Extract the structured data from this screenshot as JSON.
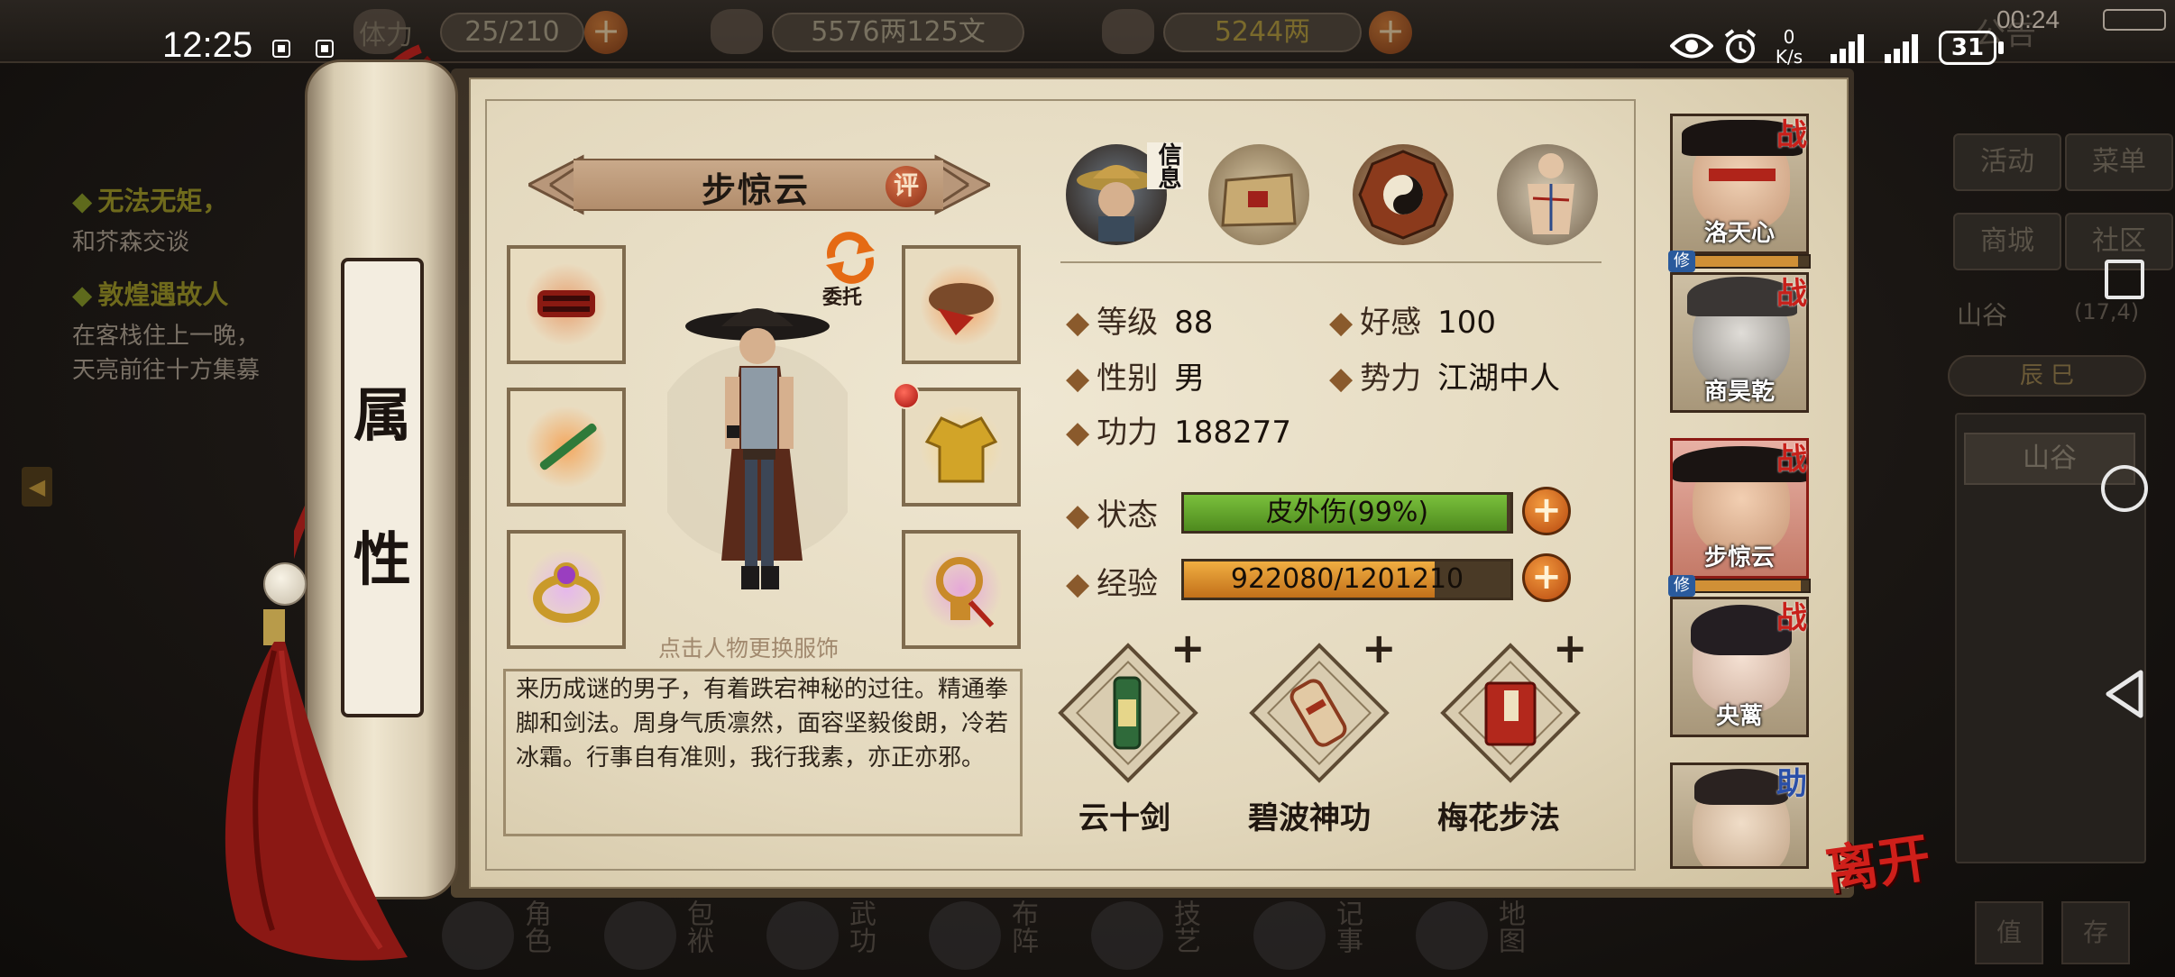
{
  "status_bar": {
    "time": "12:25",
    "net_speed_value": "0",
    "net_speed_unit": "K/s",
    "battery": "31",
    "game_clock": "00:24"
  },
  "top_bar": {
    "stamina_label": "体力",
    "stamina": "25/210",
    "silver": "5576两125文",
    "gold": "5244两",
    "right_label": "公告"
  },
  "quests": [
    {
      "title": "无法无矩，",
      "desc": "和芥森交谈"
    },
    {
      "title": "敦煌遇故人",
      "desc": "在客栈住上一晚，",
      "desc2": "天亮前往十方集募"
    }
  ],
  "right_menu": {
    "activity": "活动",
    "menu": "菜单",
    "shop": "商城",
    "community": "社区",
    "location": "山谷",
    "coords": "(17,4)",
    "time_of_day": "辰 巳",
    "location_box": "山谷",
    "btn_a": "值",
    "btn_b": "存"
  },
  "bottom_nav": [
    "角色",
    "包袱",
    "武功",
    "布阵",
    "技艺",
    "记事",
    "地图"
  ],
  "scroll": {
    "title_char_1": "属",
    "title_char_2": "性"
  },
  "character": {
    "name": "步惊云",
    "eval_label": "评",
    "delegate_label": "委托",
    "hint": "点击人物更换服饰",
    "description": "来历成谜的男子，有着跌宕神秘的过往。精通拳脚和剑法。周身气质凛然，面容坚毅俊朗，冷若冰霜。行事自有准则，我行我素，亦正亦邪。"
  },
  "tabs": {
    "info_label": "信息"
  },
  "stats": {
    "level_label": "等级",
    "level": "88",
    "favor_label": "好感",
    "favor": "100",
    "gender_label": "性别",
    "gender": "男",
    "faction_label": "势力",
    "faction": "江湖中人",
    "power_label": "功力",
    "power": "188277",
    "status_label": "状态",
    "status_text": "皮外伤(99%)",
    "status_ratio": 0.99,
    "exp_label": "经验",
    "exp_text": "922080/1201210",
    "exp_ratio": 0.7677
  },
  "skills": [
    {
      "name": "云十剑"
    },
    {
      "name": "碧波神功"
    },
    {
      "name": "梅花步法"
    }
  ],
  "skill_plus": "+",
  "party": [
    {
      "name": "洛天心",
      "tag": "战",
      "repair": "修"
    },
    {
      "name": "商昊乾",
      "tag": "战"
    },
    {
      "name": "步惊云",
      "tag": "战",
      "repair": "修"
    },
    {
      "name": "央蓠",
      "tag": "战"
    },
    {
      "name": "",
      "tag": "助"
    }
  ],
  "leave_label": "离开",
  "colors": {
    "status_bar_fill": "#5ea42a",
    "exp_bar_fill": "#e39a2e",
    "accent_red": "#cf1f1a",
    "paper": "#e9dfc6"
  }
}
